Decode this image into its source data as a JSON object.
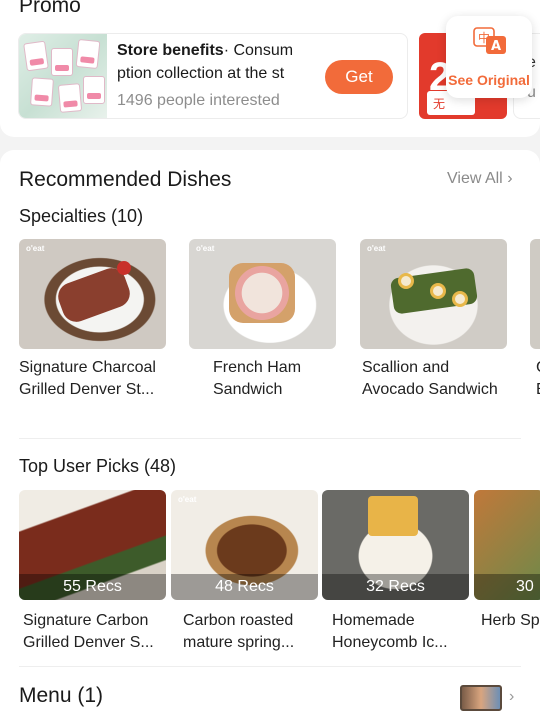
{
  "promo": {
    "title": "Promo",
    "benefit_title": "Store benefits",
    "benefit_line1_rest": "· Consum",
    "benefit_line2": "ption collection at the st",
    "interested": "1496 people interested",
    "get_label": "Get",
    "calendar_number": "2",
    "calendar_sheet_text": "无",
    "peek_text": "e",
    "peek_text_2": "u"
  },
  "translate": {
    "label": "See Original",
    "icon": "translate-icon"
  },
  "recommended": {
    "title": "Recommended Dishes",
    "view_all": "View All",
    "specialties_title": "Specialties (10)",
    "dishes": [
      {
        "name_line1": "Signature Charcoal",
        "name_line2": "Grilled Denver St...",
        "tag": "o'eat"
      },
      {
        "name_line1": "French Ham",
        "name_line2": "Sandwich",
        "tag": "o'eat"
      },
      {
        "name_line1": "Scallion and",
        "name_line2": "Avocado Sandwich",
        "tag": "o'eat"
      },
      {
        "name_line1": "C",
        "name_line2": "E",
        "tag": ""
      }
    ],
    "top_picks_title": "Top User Picks (48)",
    "picks": [
      {
        "recs": "55 Recs",
        "name_line1": "Signature Carbon",
        "name_line2": "Grilled Denver S..."
      },
      {
        "recs": "48 Recs",
        "name_line1": "Carbon roasted",
        "name_line2": "mature spring..."
      },
      {
        "recs": "32 Recs",
        "name_line1": "Homemade",
        "name_line2": "Honeycomb Ic..."
      },
      {
        "recs": "30",
        "name_line1": "Herb Sp",
        "name_line2": ""
      }
    ],
    "menu_title": "Menu (1)"
  }
}
